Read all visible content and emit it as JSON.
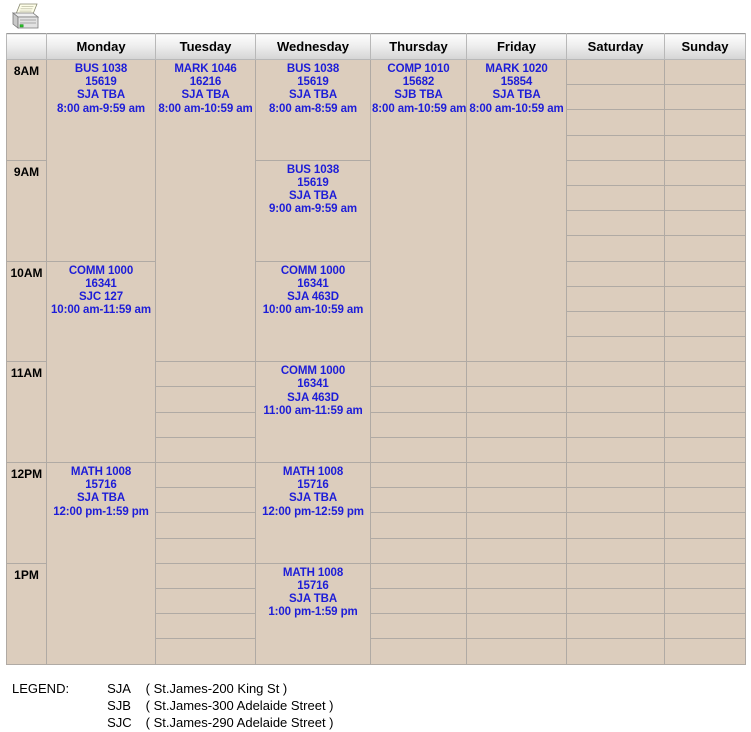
{
  "toolbar": {
    "print_icon": "printer-icon",
    "print_tooltip": "Print"
  },
  "table": {
    "time_header": "",
    "day_headers": [
      "Monday",
      "Tuesday",
      "Wednesday",
      "Thursday",
      "Friday",
      "Saturday",
      "Sunday"
    ],
    "hours": [
      "8AM",
      "9AM",
      "10AM",
      "11AM",
      "12PM",
      "1PM"
    ],
    "slots_per_hour": 4
  },
  "events": {
    "mon_8": {
      "course": "BUS 1038",
      "crn": "15619",
      "room": "SJA TBA",
      "time": "8:00 am-9:59 am"
    },
    "mon_10": {
      "course": "COMM 1000",
      "crn": "16341",
      "room": "SJC 127",
      "time": "10:00 am-11:59 am"
    },
    "mon_12": {
      "course": "MATH 1008",
      "crn": "15716",
      "room": "SJA TBA",
      "time": "12:00 pm-1:59 pm"
    },
    "tue_8": {
      "course": "MARK 1046",
      "crn": "16216",
      "room": "SJA TBA",
      "time": "8:00 am-10:59 am"
    },
    "wed_8": {
      "course": "BUS 1038",
      "crn": "15619",
      "room": "SJA TBA",
      "time": "8:00 am-8:59 am"
    },
    "wed_9": {
      "course": "BUS 1038",
      "crn": "15619",
      "room": "SJA TBA",
      "time": "9:00 am-9:59 am"
    },
    "wed_10": {
      "course": "COMM 1000",
      "crn": "16341",
      "room": "SJA 463D",
      "time": "10:00 am-10:59 am"
    },
    "wed_11": {
      "course": "COMM 1000",
      "crn": "16341",
      "room": "SJA 463D",
      "time": "11:00 am-11:59 am"
    },
    "wed_12": {
      "course": "MATH 1008",
      "crn": "15716",
      "room": "SJA TBA",
      "time": "12:00 pm-12:59 pm"
    },
    "wed_1": {
      "course": "MATH 1008",
      "crn": "15716",
      "room": "SJA TBA",
      "time": "1:00 pm-1:59 pm"
    },
    "thu_8": {
      "course": "COMP 1010",
      "crn": "15682",
      "room": "SJB TBA",
      "time": "8:00 am-10:59 am"
    },
    "fri_8": {
      "course": "MARK 1020",
      "crn": "15854",
      "room": "SJA TBA",
      "time": "8:00 am-10:59 am"
    }
  },
  "legend": {
    "title": "LEGEND:",
    "rows": [
      {
        "code": "SJA",
        "description": "( St.James-200 King St )"
      },
      {
        "code": "SJB",
        "description": "( St.James-300 Adelaide Street )"
      },
      {
        "code": "SJC",
        "description": "( St.James-290 Adelaide Street )"
      }
    ]
  },
  "colors": {
    "cell_bg": "#dccdbd",
    "event_text": "#1d1dd8",
    "border": "#b0aaa4",
    "header_bg": "#eeeeee"
  }
}
